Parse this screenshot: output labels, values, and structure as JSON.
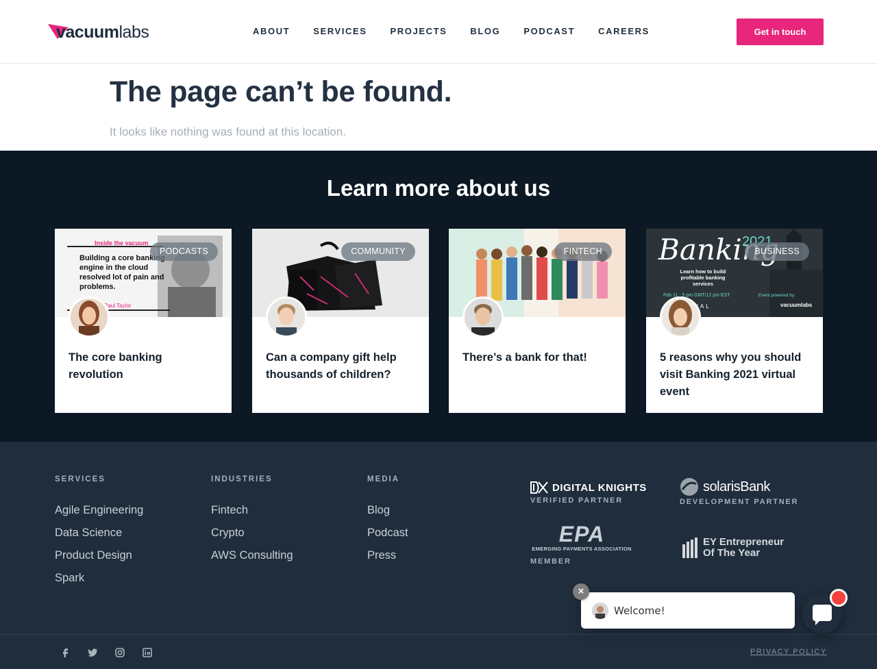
{
  "header": {
    "logo": "vacuumlabs",
    "nav": [
      "ABOUT",
      "SERVICES",
      "PROJECTS",
      "BLOG",
      "PODCAST",
      "CAREERS"
    ],
    "cta": "Get in touch",
    "accent": "#e7267c"
  },
  "not_found": {
    "title": "The page can’t be found.",
    "subtitle": "It looks like nothing was found at this location."
  },
  "learn": {
    "title": "Learn more about us",
    "cards": [
      {
        "category": "PODCASTS",
        "title": "The core banking revolution",
        "image_text": "Inside the vacuum",
        "quote": "Building a core banking engine in the cloud resolved lot of pain and problems.",
        "author": "Paul Taylor"
      },
      {
        "category": "COMMUNITY",
        "title": "Can a company gift help thousands of children?"
      },
      {
        "category": "FINTECH",
        "title": "There’s a bank for that!"
      },
      {
        "category": "BUSINESS",
        "title": "5 reasons why you should visit Banking 2021 virtual event",
        "image_text": "Banking",
        "year": "2021",
        "event_line": "Learn how to build profitable banking services",
        "date_line": "Feb 11 · 5 pm GMT/12 pm EST",
        "virtual": "VIRTUAL",
        "powered": "Event powered by:",
        "brand": "vacuumlabs"
      }
    ]
  },
  "footer": {
    "columns": [
      {
        "heading": "SERVICES",
        "links": [
          "Agile Engineering",
          "Data Science",
          "Product Design",
          "Spark"
        ]
      },
      {
        "heading": "INDUSTRIES",
        "links": [
          "Fintech",
          "Crypto",
          "AWS Consulting"
        ]
      },
      {
        "heading": "MEDIA",
        "links": [
          "Blog",
          "Podcast",
          "Press"
        ]
      }
    ],
    "partners": [
      {
        "name": "DIGITAL KNIGHTS",
        "role": "VERIFIED PARTNER"
      },
      {
        "name": "solarisBank",
        "role": "DEVELOPMENT PARTNER"
      },
      {
        "name": "EPA",
        "subname": "EMERGING PAYMENTS ASSOCIATION",
        "role": "MEMBER"
      },
      {
        "name": "EY Entrepreneur Of The Year",
        "role": ""
      }
    ],
    "social": [
      "facebook-icon",
      "twitter-icon",
      "instagram-icon",
      "linkedin-icon"
    ],
    "privacy": "PRIVACY POLICY"
  },
  "chat": {
    "message": "Welcome!"
  }
}
